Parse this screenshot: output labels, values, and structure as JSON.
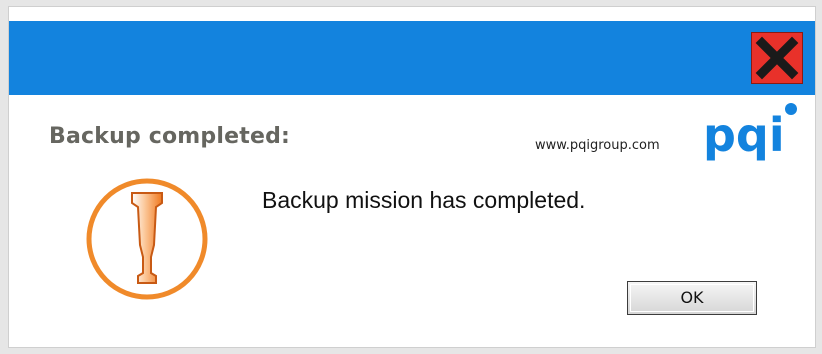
{
  "dialog": {
    "heading": "Backup completed:",
    "message": "Backup mission has completed.",
    "ok_label": "OK",
    "close_icon": "close-icon"
  },
  "brand": {
    "url": "www.pqigroup.com",
    "logo_text": "pqi"
  },
  "colors": {
    "titlebar": "#1383de",
    "close_button": "#e8312a",
    "heading_text": "#666660",
    "alert_ring": "#f08a2a",
    "brand_blue": "#1383de"
  },
  "icons": {
    "alert": "exclamation-alert-icon"
  }
}
